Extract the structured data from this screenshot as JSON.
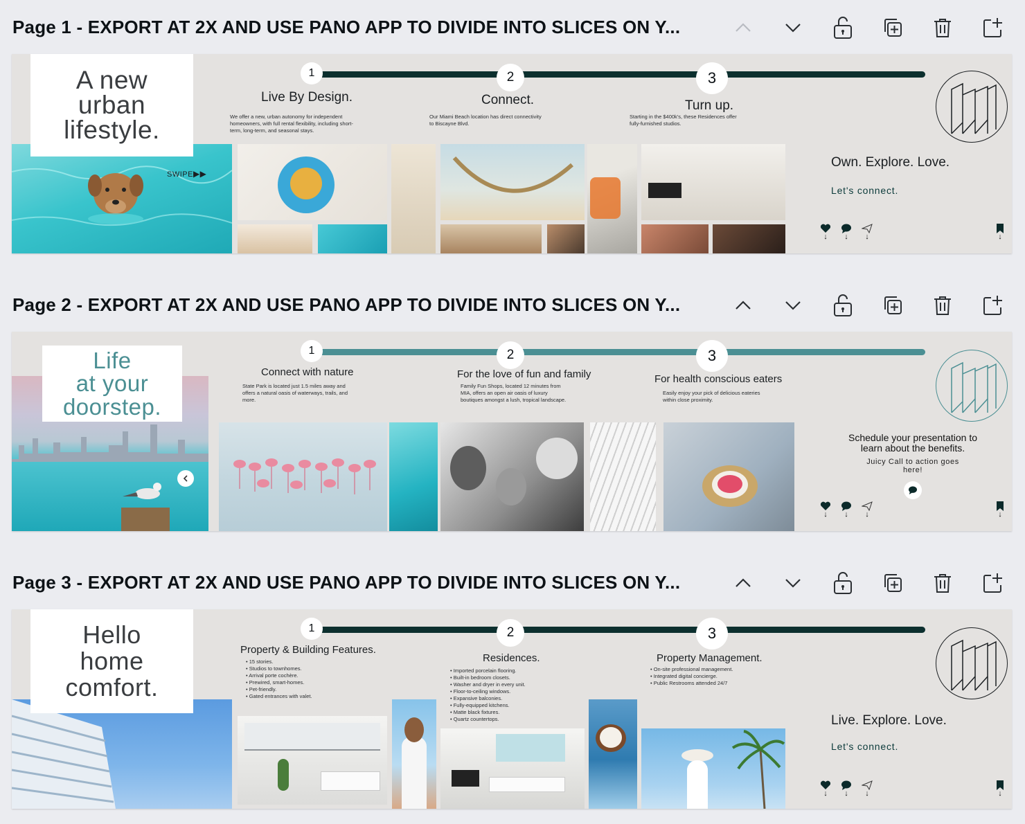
{
  "pages": [
    {
      "title": "Page 1 - EXPORT AT 2X AND USE PANO APP TO DIVIDE INTO SLICES ON Y...",
      "headline": "A new\nurban\nlifestyle.",
      "swipe": "SWIPE",
      "steps": [
        {
          "num": "1",
          "title": "Live By Design.",
          "desc": "We offer a new, urban autonomy for independent\nhomeowners, with full rental flexibility, including short-\nterm, long-term, and seasonal stays."
        },
        {
          "num": "2",
          "title": "Connect.",
          "desc": "Our  Miami Beach location has direct connectivity\nto Biscayne Blvd."
        },
        {
          "num": "3",
          "title": "Turn up.",
          "desc": "Starting in the $400k's, these Residences offer\nfully-furnished studios."
        }
      ],
      "tagline": "Own. Explore. Love.",
      "cta": "Let's connect."
    },
    {
      "title": "Page 2 - EXPORT AT 2X AND USE PANO APP TO DIVIDE INTO SLICES ON Y...",
      "headline": "Life\nat your\ndoorstep.",
      "steps": [
        {
          "num": "1",
          "title": "Connect with nature",
          "desc": "State Park is located just 1.5 miles away and\noffers a natural oasis of waterways, trails, and\nmore."
        },
        {
          "num": "2",
          "title": "For the love of fun and family",
          "desc": "Family Fun Shops, located 12 minutes from\nMIA, offers an open air oasis of luxury\nboutiques amongst a lush, tropical landscape."
        },
        {
          "num": "3",
          "title": "For health conscious eaters",
          "desc": "Easily enjoy your pick of delicious eateries\nwithin close proximity."
        }
      ],
      "schedule_title": "Schedule your presentation to\nlearn about the benefits.",
      "schedule_sub": "Juicy Call to action goes\nhere!"
    },
    {
      "title": "Page 3 - EXPORT AT 2X AND USE PANO APP TO DIVIDE INTO SLICES ON Y...",
      "headline": "Hello\nhome\ncomfort.",
      "steps": [
        {
          "num": "1",
          "title": "Property & Building Features.",
          "items": [
            "15 stories.",
            "Studios to townhomes.",
            "Arrival porte cochère.",
            "Prewired, smart-homes.",
            "Pet-friendly.",
            "Gated entrances with valet."
          ]
        },
        {
          "num": "2",
          "title": "Residences.",
          "items": [
            "Imported porcelain flooring.",
            "Built-in bedroom closets.",
            "Washer and dryer in every unit.",
            "Floor-to-ceiling windows.",
            "Expansive balconies.",
            "Fully-equipped kitchens.",
            "Matte black fixtures.",
            "Quartz countertops."
          ]
        },
        {
          "num": "3",
          "title": "Property Management.",
          "items": [
            "On-site professional management.",
            "Integrated digital concierge.",
            "Public Restrooms attended 24/7"
          ]
        }
      ],
      "tagline": "Live. Explore. Love.",
      "cta": "Let's connect."
    }
  ],
  "colors": {
    "dark_teal": "#0c2f2e",
    "light_teal": "#4b8f93",
    "slide_bg": "#e4e2e0",
    "canvas_bg": "#ebecf0"
  },
  "icons": [
    "chevron-up-icon",
    "chevron-down-icon",
    "lock-icon",
    "duplicate-icon",
    "trash-icon",
    "add-page-icon",
    "heart-icon",
    "comment-icon",
    "send-icon",
    "bookmark-icon"
  ]
}
